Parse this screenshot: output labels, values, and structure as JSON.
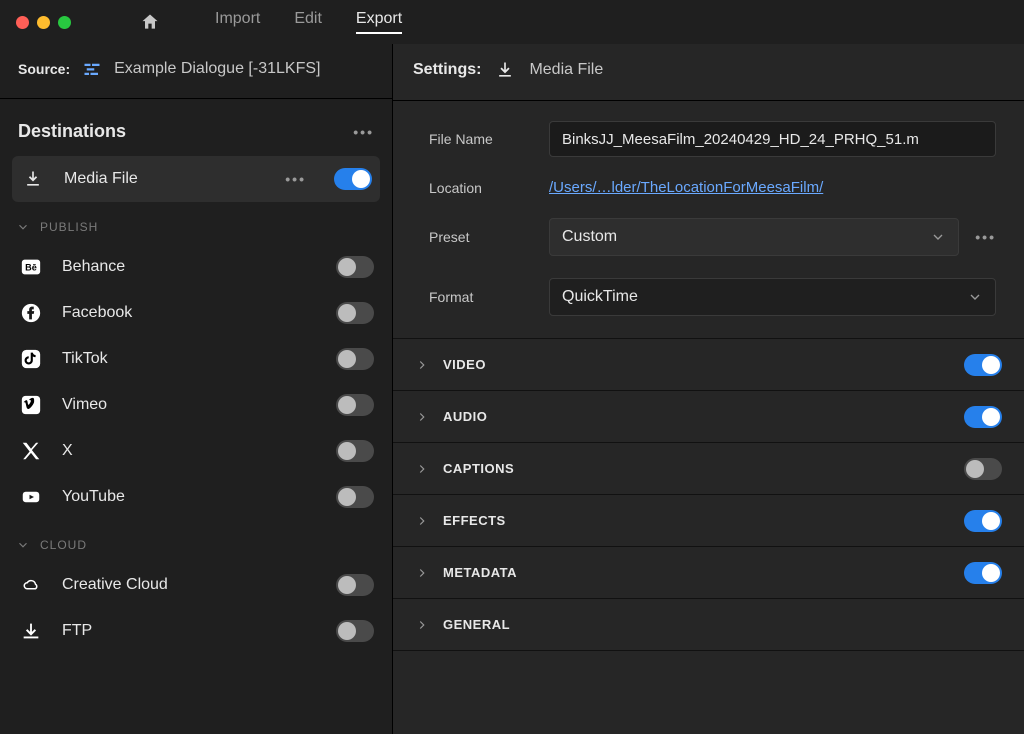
{
  "topbar": {
    "tabs": [
      "Import",
      "Edit",
      "Export"
    ],
    "active_tab": 2
  },
  "source": {
    "label": "Source:",
    "name": "Example Dialogue [-31LKFS]"
  },
  "destinations": {
    "label": "Destinations",
    "media_file_label": "Media File",
    "publish_label": "PUBLISH",
    "cloud_label": "CLOUD",
    "publish_items": [
      {
        "label": "Behance",
        "on": false
      },
      {
        "label": "Facebook",
        "on": false
      },
      {
        "label": "TikTok",
        "on": false
      },
      {
        "label": "Vimeo",
        "on": false
      },
      {
        "label": "X",
        "on": false
      },
      {
        "label": "YouTube",
        "on": false
      }
    ],
    "cloud_items": [
      {
        "label": "Creative Cloud",
        "on": false
      },
      {
        "label": "FTP",
        "on": false
      }
    ]
  },
  "settings": {
    "label": "Settings:",
    "title": "Media File",
    "file_name_label": "File Name",
    "file_name_value": "BinksJJ_MeesaFilm_20240429_HD_24_PRHQ_51.m",
    "location_label": "Location",
    "location_value": "/Users/…lder/TheLocationForMeesaFilm/",
    "preset_label": "Preset",
    "preset_value": "Custom",
    "format_label": "Format",
    "format_value": "QuickTime",
    "sections": [
      {
        "label": "VIDEO",
        "on": true
      },
      {
        "label": "AUDIO",
        "on": true
      },
      {
        "label": "CAPTIONS",
        "on": false
      },
      {
        "label": "EFFECTS",
        "on": true
      },
      {
        "label": "METADATA",
        "on": true
      },
      {
        "label": "GENERAL",
        "on": null
      }
    ]
  }
}
